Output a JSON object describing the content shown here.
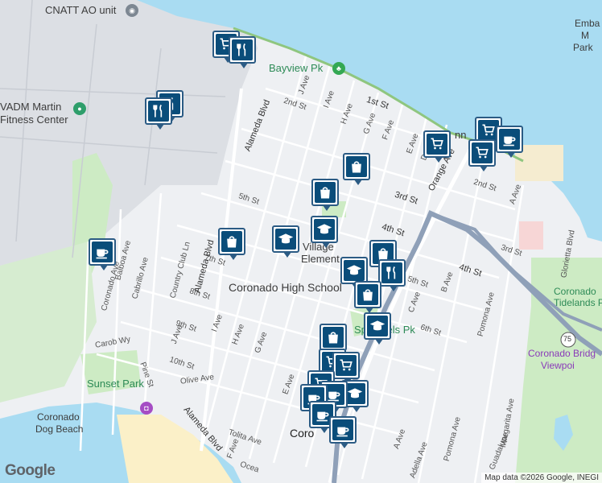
{
  "map": {
    "attribution": "Map data ©2026 Google, INEGI",
    "logo": "Google",
    "colors": {
      "water": "#a9dcf2",
      "land": "#eef0f3",
      "park": "#cdebc4",
      "road": "#ffffff",
      "highway": "#8fa0b8",
      "beach": "#fbf0c8",
      "marker": "#2b5b84",
      "marker_fill": "#0a4d7a"
    },
    "place_labels": {
      "cnatt": "CNATT AO unit",
      "bayview": "Bayview Pk",
      "martin": "VADM Martin",
      "fitness": "Fitness Center",
      "village": "Village",
      "elementary": "Element",
      "high_school": "Coronado High School",
      "spreckels": "Spreckels Pk",
      "sunset": "Sunset Park",
      "dog_beach_1": "Coronado",
      "dog_beach_2": "Dog Beach",
      "tidelands_1": "Coronado",
      "tidelands_2": "Tidelands P",
      "bridge_1": "Coronado Bridg",
      "bridge_2": "Viewpoi",
      "emb_1": "Emba",
      "emb_2": "M",
      "emb_3": "Park",
      "coronado_town": "Coro",
      "penny": "nn"
    },
    "streets": {
      "first_st": "1st St",
      "second_st": "2nd St",
      "second_st_e": "2nd St",
      "third_st": "3rd St",
      "third_st_e": "3rd St",
      "fourth_st": "4th St",
      "fourth_st_e": "4th St",
      "fifth_st": "5th St",
      "fifth_st_e": "5th St",
      "sixth_st": "6th St",
      "seventh_st": "7th St",
      "eighth_st": "8th St",
      "ninth_st": "9th St",
      "tenth_st": "10th St",
      "olive": "Olive Ave",
      "carob": "Carob Wy",
      "pine": "Pine St",
      "tolita": "Tolita Ave",
      "ocean": "Ocea",
      "alameda_n": "Alameda Blvd",
      "alameda_mid": "Alameda Blvd",
      "alameda_s": "Alameda Blvd",
      "orange": "Orange Ave",
      "j_ave": "J Ave",
      "i_ave": "I Ave",
      "h_ave": "H Ave",
      "g_ave": "G Ave",
      "f_ave": "F Ave",
      "e_ave": "E Ave",
      "d_ave": "D",
      "c_ave": "C Ave",
      "b_ave": "B Ave",
      "a_ave": "A Ave",
      "a_ave_s": "A Ave",
      "j_ave_s": "J Ave",
      "i_ave_s": "I Ave",
      "h_ave_s": "H Ave",
      "g_ave_s": "G Ave",
      "e_ave_s": "E Ave",
      "f_ave_s": "F Ave",
      "balboa": "Balboa Ave",
      "cabrillo": "Cabrillo Ave",
      "country_club": "Country Club Ln",
      "coronado_ave": "Coronado Ave",
      "pomona_n": "Pomona Ave",
      "pomona_s": "Pomona Ave",
      "margarita": "Margarita Ave",
      "guadalupe": "Guadalupe",
      "adella": "Adella Ave",
      "glorietta": "Glorietta Blvd",
      "route_75": "75"
    },
    "markers": [
      {
        "type": "shopping-cart"
      },
      {
        "type": "restaurant"
      },
      {
        "type": "restaurant"
      },
      {
        "type": "restaurant"
      },
      {
        "type": "shopping-bag"
      },
      {
        "type": "shopping-bag"
      },
      {
        "type": "school"
      },
      {
        "type": "school"
      },
      {
        "type": "shopping-bag"
      },
      {
        "type": "coffee"
      },
      {
        "type": "shopping-bag"
      },
      {
        "type": "restaurant"
      },
      {
        "type": "school"
      },
      {
        "type": "shopping-bag"
      },
      {
        "type": "school"
      },
      {
        "type": "shopping-bag"
      },
      {
        "type": "shopping-cart"
      },
      {
        "type": "shopping-cart"
      },
      {
        "type": "shopping-cart"
      },
      {
        "type": "shopping-cart"
      },
      {
        "type": "coffee"
      },
      {
        "type": "shopping-cart"
      },
      {
        "type": "shopping-cart"
      },
      {
        "type": "school"
      },
      {
        "type": "coffee"
      },
      {
        "type": "coffee"
      },
      {
        "type": "coffee"
      },
      {
        "type": "coffee"
      }
    ]
  }
}
